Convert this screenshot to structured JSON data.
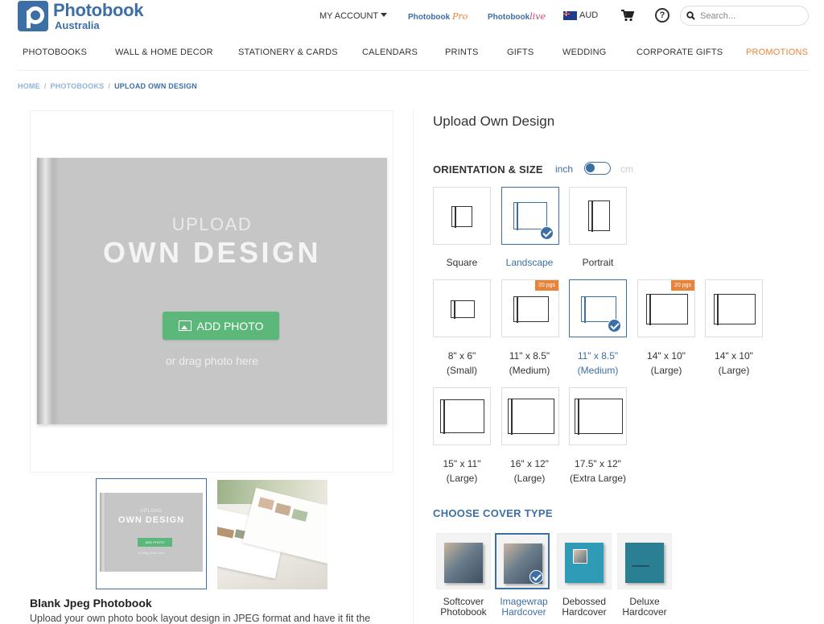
{
  "header": {
    "logo_main": "Photobook",
    "logo_sub": "Australia",
    "account": "MY ACCOUNT",
    "pro_a": "Photobook",
    "pro_b": "Pro",
    "live_a": "Photobook",
    "live_b": "live",
    "currency": "AUD",
    "help": "?",
    "search_placeholder": "Search..."
  },
  "nav": [
    "PHOTOBOOKS",
    "WALL & HOME DECOR",
    "STATIONERY & CARDS",
    "CALENDARS",
    "PRINTS",
    "GIFTS",
    "WEDDING",
    "CORPORATE GIFTS",
    "PROMOTIONS"
  ],
  "breadcrumb": {
    "home": "HOME",
    "photobooks": "PHOTOBOOKS",
    "current": "UPLOAD OWN DESIGN",
    "sep": "/"
  },
  "preview": {
    "upload": "UPLOAD",
    "own_design": "OWN DESIGN",
    "add_photo": "ADD PHOTO",
    "drag": "or drag photo here"
  },
  "thumb": {
    "upload": "UPLOAD",
    "own_design": "OWN DESIGN",
    "add_photo": "ADD PHOTO",
    "drag": "or drag photo here"
  },
  "product": {
    "title": "Blank Jpeg Photobook",
    "desc": "Upload your own photo book layout design in JPEG format and have it fit the"
  },
  "config": {
    "title": "Upload Own Design",
    "orientation_label": "ORIENTATION & SIZE",
    "unit_inch": "inch",
    "unit_cm": "cm",
    "orientations": [
      "Square",
      "Landscape",
      "Portrait"
    ],
    "sizes": [
      {
        "l1": "8\" x 6\"",
        "l2": "(Small)"
      },
      {
        "l1": "11\" x 8.5\"",
        "l2": "(Medium)",
        "badge": "20 pgs"
      },
      {
        "l1": "11\" x 8.5\"",
        "l2": "(Medium)"
      },
      {
        "l1": "14\" x 10\"",
        "l2": "(Large)",
        "badge": "20 pgs"
      },
      {
        "l1": "14\" x 10\"",
        "l2": "(Large)"
      },
      {
        "l1": "15\" x 11\"",
        "l2": "(Large)"
      },
      {
        "l1": "16\" x 12\"",
        "l2": "(Large)"
      },
      {
        "l1": "17.5\" x 12\"",
        "l2": "(Extra Large)"
      }
    ],
    "cover_label": "CHOOSE COVER TYPE",
    "covers": [
      {
        "l1": "Softcover",
        "l2": "Photobook"
      },
      {
        "l1": "Imagewrap",
        "l2": "Hardcover"
      },
      {
        "l1": "Debossed",
        "l2": "Hardcover"
      },
      {
        "l1": "Deluxe",
        "l2": "Hardcover"
      }
    ]
  },
  "colors": {
    "brand": "#3c6fa5",
    "promo": "#e8843a",
    "add_button": "#5cb87a"
  }
}
